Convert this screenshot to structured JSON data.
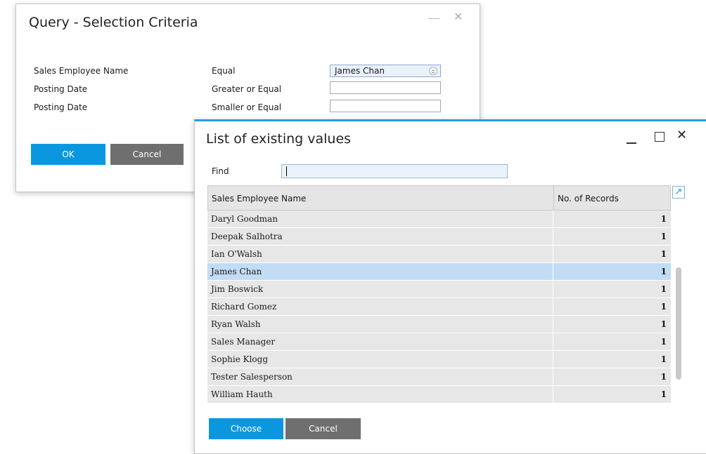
{
  "query_window": {
    "title": "Query - Selection Criteria",
    "criteria": [
      {
        "field": "Sales Employee Name",
        "operator": "Equal",
        "value": "James Chan"
      },
      {
        "field": "Posting Date",
        "operator": "Greater or Equal",
        "value": ""
      },
      {
        "field": "Posting Date",
        "operator": "Smaller or Equal",
        "value": ""
      }
    ],
    "ok_label": "OK",
    "cancel_label": "Cancel"
  },
  "list_window": {
    "title": "List of existing values",
    "find_label": "Find",
    "find_value": "",
    "columns": [
      "Sales Employee Name",
      "No. of Records"
    ],
    "rows": [
      {
        "name": "Daryl Goodman",
        "count": "1"
      },
      {
        "name": "Deepak Salhotra",
        "count": "1"
      },
      {
        "name": "Ian O'Walsh",
        "count": "1"
      },
      {
        "name": "James Chan",
        "count": "1"
      },
      {
        "name": "Jim Boswick",
        "count": "1"
      },
      {
        "name": "Richard Gomez",
        "count": "1"
      },
      {
        "name": "Ryan Walsh",
        "count": "1"
      },
      {
        "name": "Sales Manager",
        "count": "1"
      },
      {
        "name": "Sophie Klogg",
        "count": "1"
      },
      {
        "name": "Tester Salesperson",
        "count": "1"
      },
      {
        "name": "William Hauth",
        "count": "1"
      }
    ],
    "selected_row": "James Chan",
    "choose_label": "Choose",
    "cancel_label": "Cancel"
  },
  "colors": {
    "primary_button": "#0b97e0",
    "secondary_button": "#6f6f6f",
    "selected_row": "#c3dcf5",
    "title_accent": "#1ea1e8"
  },
  "icons": {
    "minimize": "minimize-icon",
    "maximize": "maximize-icon",
    "close": "close-icon",
    "lookup": "lookup-icon",
    "expand": "expand-arrow-icon"
  }
}
